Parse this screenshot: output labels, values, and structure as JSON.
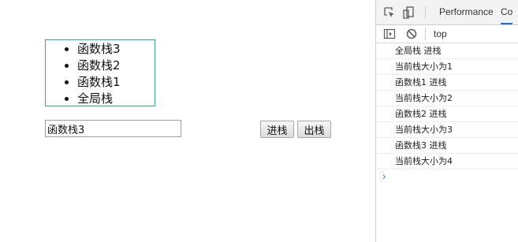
{
  "stack": {
    "items": [
      "函数栈3",
      "函数栈2",
      "函数栈1",
      "全局栈"
    ]
  },
  "input": {
    "value": "函数栈3"
  },
  "buttons": {
    "push_label": "进栈",
    "pop_label": "出栈"
  },
  "devtools": {
    "tabs": [
      "Performance",
      "Co"
    ],
    "context": "top",
    "icons": [
      "inspect-element-icon",
      "device-toolbar-icon",
      "sidebar-toggle-icon",
      "clear-console-icon"
    ],
    "accent": "#1a73e8",
    "console_lines": [
      "全局栈 进栈",
      "当前栈大小为1",
      "函数栈1 进栈",
      "当前栈大小为2",
      "函数栈2 进栈",
      "当前栈大小为3",
      "函数栈3 进栈",
      "当前栈大小为4"
    ],
    "prompt": "›"
  }
}
